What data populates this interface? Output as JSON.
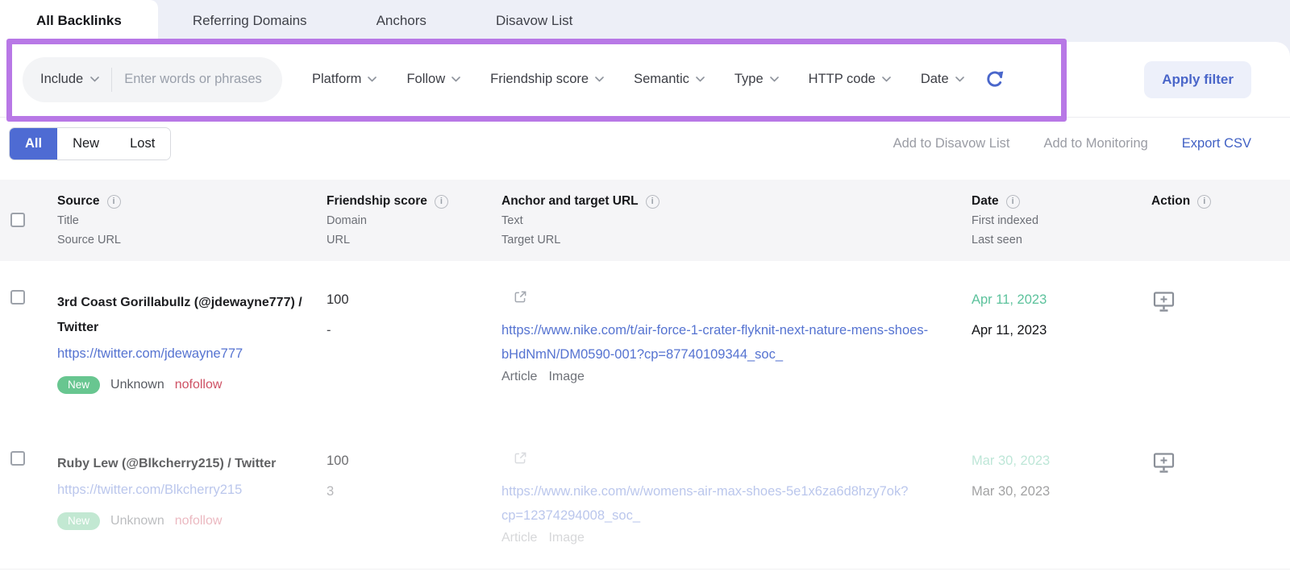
{
  "tabs": {
    "items": [
      "All Backlinks",
      "Referring Domains",
      "Anchors",
      "Disavow List"
    ],
    "active": "All Backlinks"
  },
  "filter_bar": {
    "include_label": "Include",
    "search_placeholder": "Enter words or phrases",
    "dropdowns": [
      "Platform",
      "Follow",
      "Friendship score",
      "Semantic",
      "Type",
      "HTTP code",
      "Date"
    ],
    "apply_button_label": "Apply filter"
  },
  "toolbar": {
    "segments": [
      "All",
      "New",
      "Lost"
    ],
    "active_segment": "All",
    "add_to_disavow_label": "Add to Disavow List",
    "add_to_monitoring_label": "Add to Monitoring",
    "export_csv_label": "Export CSV"
  },
  "table": {
    "header": {
      "source": {
        "title": "Source",
        "sub1": "Title",
        "sub2": "Source URL"
      },
      "score": {
        "title": "Friendship score",
        "sub1": "Domain",
        "sub2": "URL"
      },
      "anchor": {
        "title": "Anchor and target URL",
        "sub1": "Text",
        "sub2": "Target URL"
      },
      "date": {
        "title": "Date",
        "sub1": "First indexed",
        "sub2": "Last seen"
      },
      "action": {
        "title": "Action"
      }
    },
    "rows": [
      {
        "title": "3rd Coast Gorillabullz (@jdewayne777) / Twitter",
        "source_url": "https://twitter.com/jdewayne777",
        "badge": "New",
        "platform": "Unknown",
        "follow": "nofollow",
        "score_domain": "100",
        "score_url": "-",
        "target_url": "https://www.nike.com/t/air-force-1-crater-flyknit-next-nature-mens-shoes-bHdNmN/DM0590-001?cp=87740109344_soc_",
        "tags": [
          "Article",
          "Image"
        ],
        "first_indexed": "Apr 11, 2023",
        "last_seen": "Apr 11, 2023"
      },
      {
        "title": "Ruby Lew (@Blkcherry215) / Twitter",
        "source_url": "https://twitter.com/Blkcherry215",
        "badge": "New",
        "platform": "Unknown",
        "follow": "nofollow",
        "score_domain": "100",
        "score_url": "3",
        "target_url": "https://www.nike.com/w/womens-air-max-shoes-5e1x6za6d8hzy7ok?cp=12374294008_soc_",
        "tags": [
          "Article",
          "Image"
        ],
        "first_indexed": "Mar 30, 2023",
        "last_seen": "Mar 30, 2023"
      }
    ]
  },
  "colors": {
    "highlight_purple": "#b878e6",
    "accent_blue": "#4a66c9",
    "badge_green": "#68c690",
    "date_green": "#5cc29c",
    "nofollow_red": "#ce5063",
    "link_blue": "#5573d1"
  }
}
